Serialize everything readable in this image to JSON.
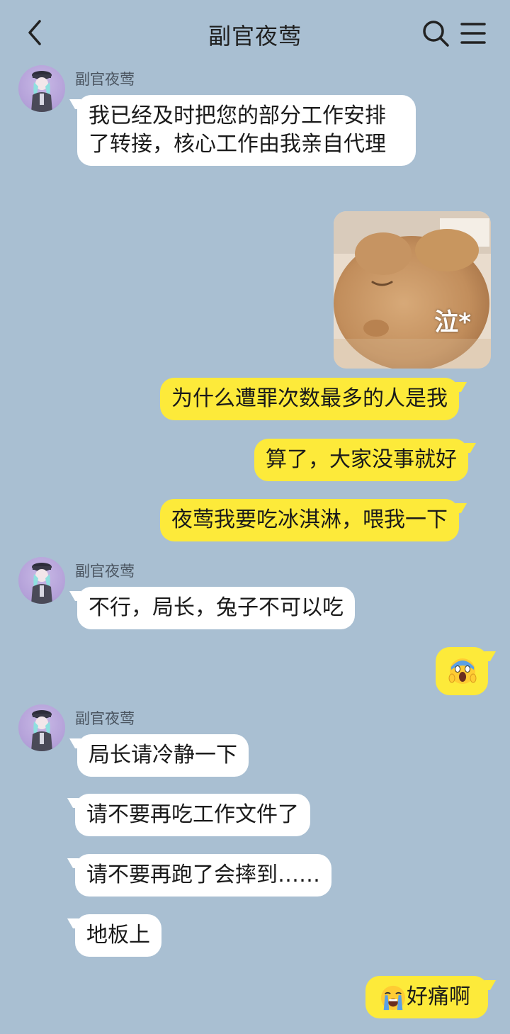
{
  "header": {
    "title": "副官夜莺",
    "back_icon": "chevron-left-icon",
    "search_icon": "search-icon",
    "menu_icon": "hamburger-menu-icon"
  },
  "contact": {
    "name": "副官夜莺"
  },
  "colors": {
    "background": "#a9bfd2",
    "incoming_bubble": "#ffffff",
    "outgoing_bubble": "#fdea3a"
  },
  "messages": [
    {
      "from": "contact",
      "text": "我已经及时把您的部分工作安排了转接，核心工作由我亲自代理"
    },
    {
      "from": "me",
      "type": "sticker",
      "caption": "泣*"
    },
    {
      "from": "me",
      "text": "为什么遭罪次数最多的人是我"
    },
    {
      "from": "me",
      "text": "算了，大家没事就好"
    },
    {
      "from": "me",
      "text": "夜莺我要吃冰淇淋，喂我一下"
    },
    {
      "from": "contact",
      "text": "不行，局长，兔子不可以吃"
    },
    {
      "from": "me",
      "type": "emoji",
      "emoji": "scream-face"
    },
    {
      "from": "contact",
      "text": "局长请冷静一下"
    },
    {
      "from": "contact",
      "text": "请不要再吃工作文件了"
    },
    {
      "from": "contact",
      "text": "请不要再跑了会摔到……"
    },
    {
      "from": "contact",
      "text": "地板上"
    },
    {
      "from": "me",
      "emoji": "loudly-crying-face",
      "text": "好痛啊"
    }
  ]
}
